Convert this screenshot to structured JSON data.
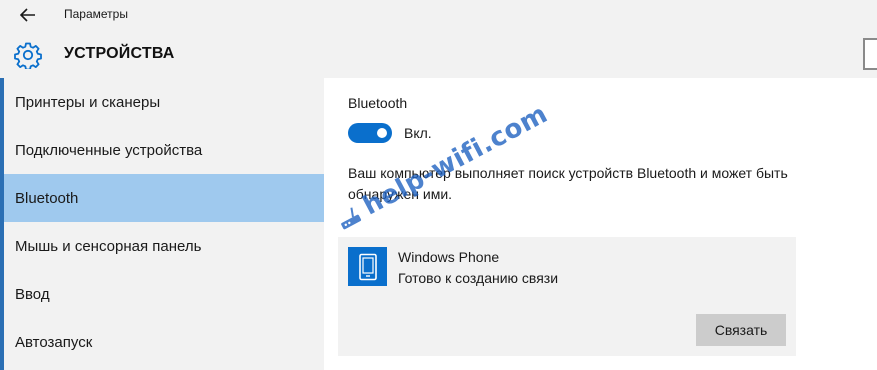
{
  "window": {
    "app_title": "Параметры",
    "page_title": "УСТРОЙСТВА"
  },
  "sidebar": {
    "items": [
      {
        "label": "Принтеры и сканеры",
        "selected": false
      },
      {
        "label": "Подключенные устройства",
        "selected": false
      },
      {
        "label": "Bluetooth",
        "selected": true
      },
      {
        "label": "Мышь и сенсорная панель",
        "selected": false
      },
      {
        "label": "Ввод",
        "selected": false
      },
      {
        "label": "Автозапуск",
        "selected": false
      }
    ]
  },
  "main": {
    "section_title": "Bluetooth",
    "toggle": {
      "label": "Вкл.",
      "on": true
    },
    "description": "Ваш компьютер выполняет поиск устройств Bluetooth и может быть обнаружен ими.",
    "device": {
      "name": "Windows Phone",
      "status": "Готово к созданию связи",
      "icon": "phone-icon",
      "connect_label": "Связать"
    }
  },
  "watermark": {
    "text": "help-wifi.com"
  },
  "colors": {
    "accent": "#0a6fcc",
    "selected_bg": "#9fc9ee",
    "panel_bg": "#f2f2f2",
    "button_bg": "#cccccc"
  },
  "icons": {
    "back": "back-arrow-icon",
    "settings": "gear-icon",
    "device": "phone-icon"
  }
}
